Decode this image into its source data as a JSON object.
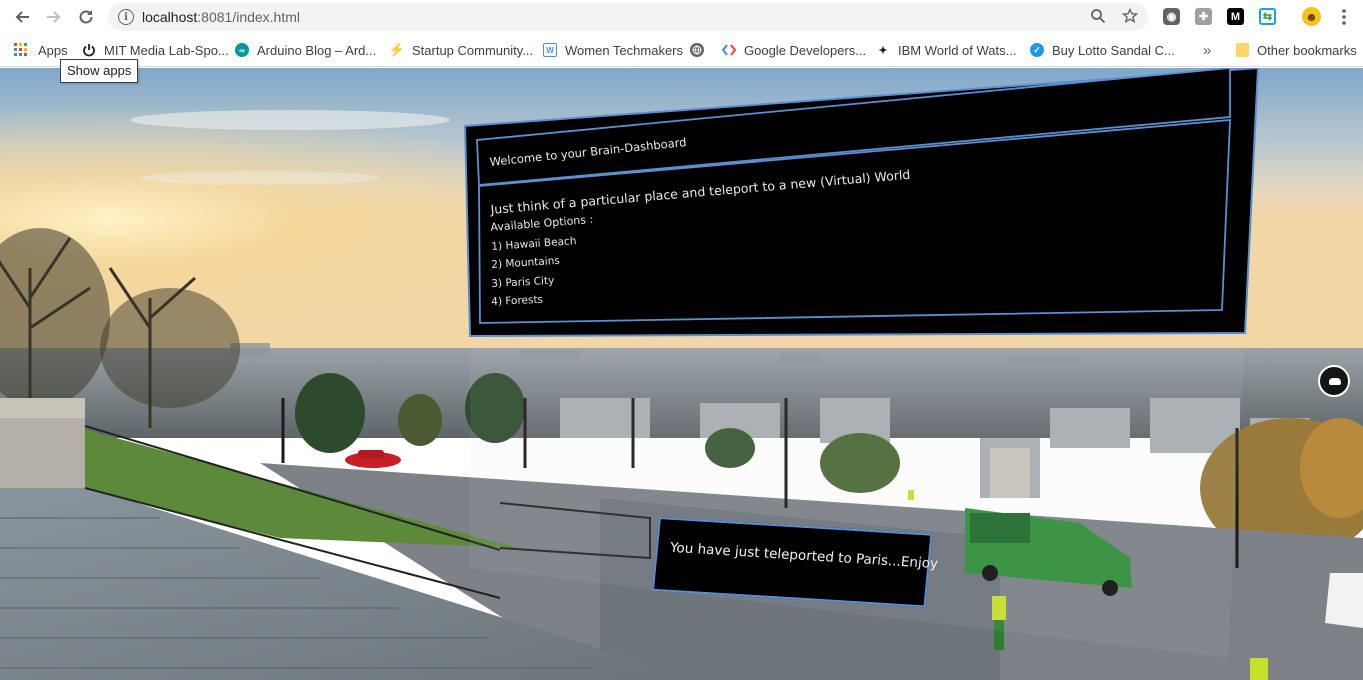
{
  "browser": {
    "url_host": "localhost",
    "url_port": ":8081",
    "url_path": "/index.html",
    "back_icon": "arrow-left-icon",
    "forward_icon": "arrow-right-icon",
    "reload_icon": "reload-icon",
    "zoom_icon": "magnifier-icon",
    "star_icon": "star-icon",
    "menu_icon": "kebab-menu-icon"
  },
  "bookmarks": {
    "apps": "Apps",
    "items": [
      {
        "label": "MIT Media Lab-Spo...",
        "color": "#202124"
      },
      {
        "label": "Arduino Blog – Ard...",
        "color": "#00979d"
      },
      {
        "label": "Startup Community...",
        "color": "#1aa0d8"
      },
      {
        "label": "Women Techmakers",
        "color": "#4a90d9"
      },
      {
        "label": "",
        "color": "#5f6368"
      },
      {
        "label": "Google Developers...",
        "color": "#4285f4"
      },
      {
        "label": "IBM World of Wats...",
        "color": "#202124"
      },
      {
        "label": "Buy Lotto Sandal C...",
        "color": "#1a9be6"
      }
    ],
    "overflow": "»",
    "other": "Other bookmarks"
  },
  "tooltip": "Show apps",
  "dashboard": {
    "title": "Welcome to your Brain-Dashboard",
    "intro": "Just think of a particular place and teleport to a new (Virtual) World",
    "options_heading": "Available Options :",
    "options": [
      "1) Hawaii Beach",
      "2) Mountains",
      "3) Paris City",
      "4) Forests"
    ]
  },
  "toast": "You have just teleported to Paris...Enjoy",
  "colors": {
    "panel_border": "#5b8fd0",
    "panel_bg": "#000000"
  }
}
